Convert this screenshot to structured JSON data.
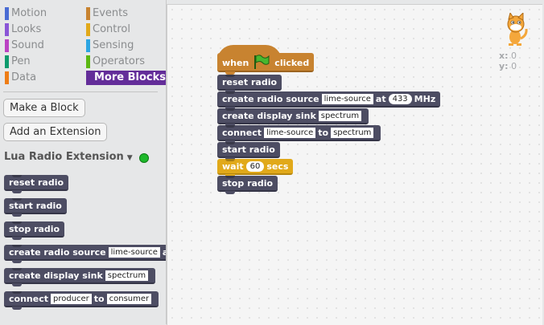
{
  "categories": [
    {
      "label": "Motion",
      "color": "#4a6cd4"
    },
    {
      "label": "Events",
      "color": "#c88330"
    },
    {
      "label": "Looks",
      "color": "#8a55d7"
    },
    {
      "label": "Control",
      "color": "#e1a91a"
    },
    {
      "label": "Sound",
      "color": "#bb42c3"
    },
    {
      "label": "Sensing",
      "color": "#2ca5e2"
    },
    {
      "label": "Pen",
      "color": "#0e9a6c"
    },
    {
      "label": "Operators",
      "color": "#5cb712"
    },
    {
      "label": "Data",
      "color": "#ee7d16"
    },
    {
      "label": "More Blocks",
      "color": "#632d99"
    }
  ],
  "buttons": {
    "make_block": "Make a Block",
    "add_extension": "Add an Extension"
  },
  "extension": {
    "title": "Lua Radio Extension",
    "status_color": "#1eb82b"
  },
  "palette_blocks": {
    "reset": "reset radio",
    "start": "start radio",
    "stop": "stop radio",
    "create_source": "create radio source",
    "create_source_input": "lime-source",
    "create_source_at": "at",
    "create_sink": "create display sink",
    "create_sink_input": "spectrum",
    "connect": "connect",
    "connect_input1": "producer",
    "connect_to": "to",
    "connect_input2": "consumer"
  },
  "script": {
    "hat_when": "when",
    "hat_clicked": "clicked",
    "reset": "reset radio",
    "create_source": "create radio source",
    "create_source_input": "lime-source",
    "create_source_at": "at",
    "create_source_freq": "433",
    "create_source_unit": "MHz",
    "create_sink": "create display sink",
    "create_sink_input": "spectrum",
    "connect": "connect",
    "connect_input1": "lime-source",
    "connect_to": "to",
    "connect_input2": "spectrum",
    "start": "start radio",
    "wait": "wait",
    "wait_value": "60",
    "wait_unit": "secs",
    "stop": "stop radio"
  },
  "sprite_info": {
    "x_label": "x:",
    "x_value": "0",
    "y_label": "y:",
    "y_value": "0"
  }
}
